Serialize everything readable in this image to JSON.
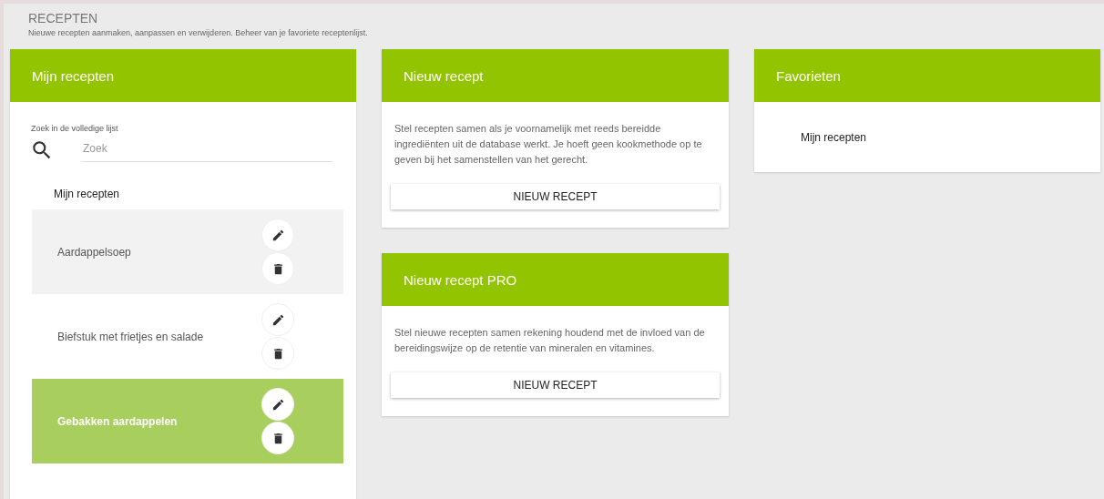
{
  "page": {
    "title": "RECEPTEN",
    "subtitle": "Nieuwe recepten aanmaken, aanpassen en verwijderen. Beheer van je favoriete receptenlijst."
  },
  "my_recipes": {
    "title": "Mijn recepten",
    "search_label": "Zoek in de volledige lijst",
    "search": {
      "placeholder": "Zoek"
    },
    "list_heading": "Mijn recepten",
    "items": [
      {
        "name": "Aardappelsoep",
        "selected": false,
        "hovered": true
      },
      {
        "name": "Biefstuk met frietjes en salade",
        "selected": false,
        "hovered": false
      },
      {
        "name": "Gebakken aardappelen",
        "selected": true,
        "hovered": false
      }
    ]
  },
  "cards": [
    {
      "title": "Nieuw recept",
      "text": "Stel recepten samen als je voornamelijk met reeds bereidde ingrediënten uit de database werkt. Je hoeft geen kookmethode op te geven bij het samenstellen van het gerecht.",
      "button": "NIEUW RECEPT"
    },
    {
      "title": "Nieuw recept PRO",
      "text": "Stel nieuwe recepten samen rekening houdend met de invloed van de bereidingswijze op de retentie van mineralen en vitamines.",
      "button": "NIEUW RECEPT"
    }
  ],
  "favorites": {
    "title": "Favorieten",
    "items": [
      "Mijn recepten"
    ]
  }
}
